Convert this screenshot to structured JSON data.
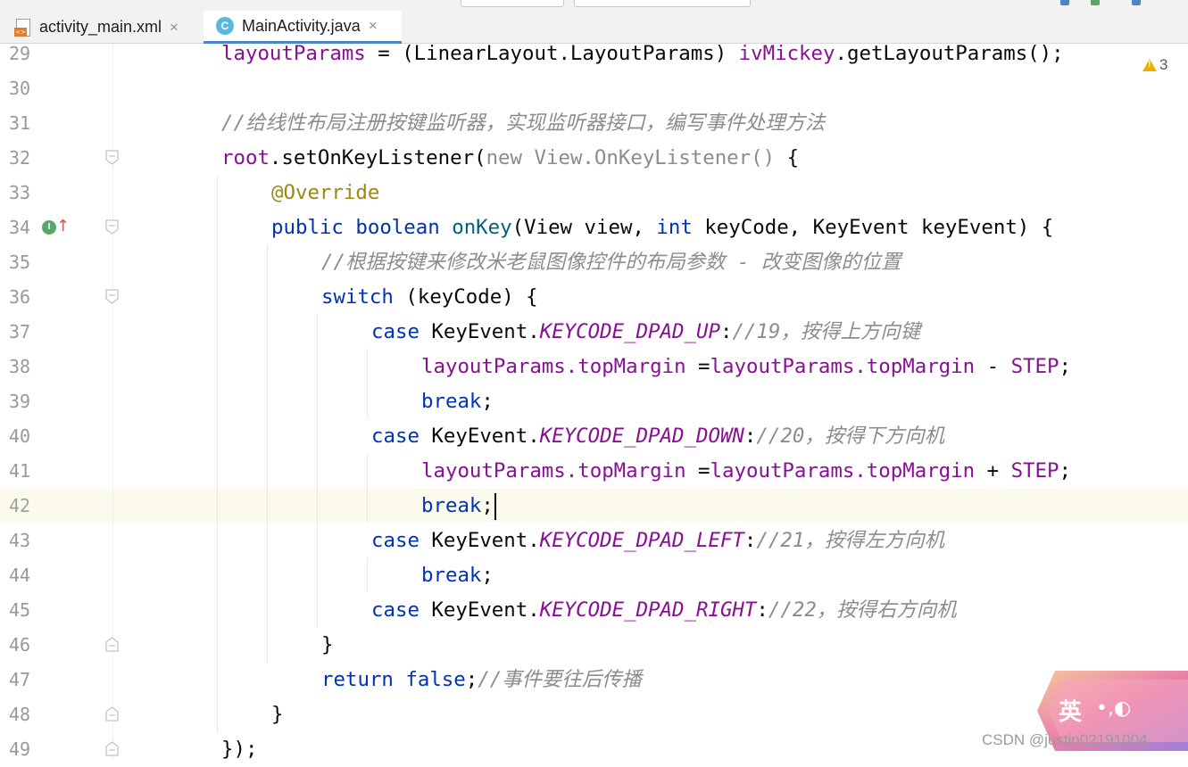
{
  "tabs": [
    {
      "label": "activity_main.xml",
      "icon": "xml-file-icon",
      "active": false
    },
    {
      "label": "MainActivity.java",
      "icon": "java-class-icon",
      "active": true
    }
  ],
  "tab_close_glyph": "×",
  "warnings": {
    "count": "3"
  },
  "gutter_markers": {
    "implements": "I",
    "arrow": "↑"
  },
  "ime": {
    "label": "英",
    "glyphs": "•,◐"
  },
  "watermark": "CSDN @justin02191004",
  "current_line": "42",
  "lines": [
    {
      "num": "29",
      "text": "layoutParams = (LinearLayout.LayoutParams) ivMickey.getLayoutParams();"
    },
    {
      "num": "30",
      "text": ""
    },
    {
      "num": "31",
      "text": "//给线性布局注册按键监听器，实现监听器接口，编写事件处理方法"
    },
    {
      "num": "32",
      "text": "root.setOnKeyListener(new View.OnKeyListener() {"
    },
    {
      "num": "33",
      "text": "@Override"
    },
    {
      "num": "34",
      "text": "public boolean onKey(View view, int keyCode, KeyEvent keyEvent) {"
    },
    {
      "num": "35",
      "text": "//根据按键来修改米老鼠图像控件的布局参数 - 改变图像的位置"
    },
    {
      "num": "36",
      "text": "switch (keyCode) {"
    },
    {
      "num": "37",
      "text": "case KeyEvent.KEYCODE_DPAD_UP://19，按得上方向键"
    },
    {
      "num": "38",
      "text": "layoutParams.topMargin =layoutParams.topMargin - STEP;"
    },
    {
      "num": "39",
      "text": "break;"
    },
    {
      "num": "40",
      "text": "case KeyEvent.KEYCODE_DPAD_DOWN://20，按得下方向机"
    },
    {
      "num": "41",
      "text": "layoutParams.topMargin =layoutParams.topMargin + STEP;"
    },
    {
      "num": "42",
      "text": "break;"
    },
    {
      "num": "43",
      "text": "case KeyEvent.KEYCODE_DPAD_LEFT://21，按得左方向机"
    },
    {
      "num": "44",
      "text": "break;"
    },
    {
      "num": "45",
      "text": "case KeyEvent.KEYCODE_DPAD_RIGHT://22，按得右方向机"
    },
    {
      "num": "46",
      "text": "}"
    },
    {
      "num": "47",
      "text": "return false;//事件要往后传播"
    },
    {
      "num": "48",
      "text": "}"
    },
    {
      "num": "49",
      "text": "});"
    }
  ]
}
